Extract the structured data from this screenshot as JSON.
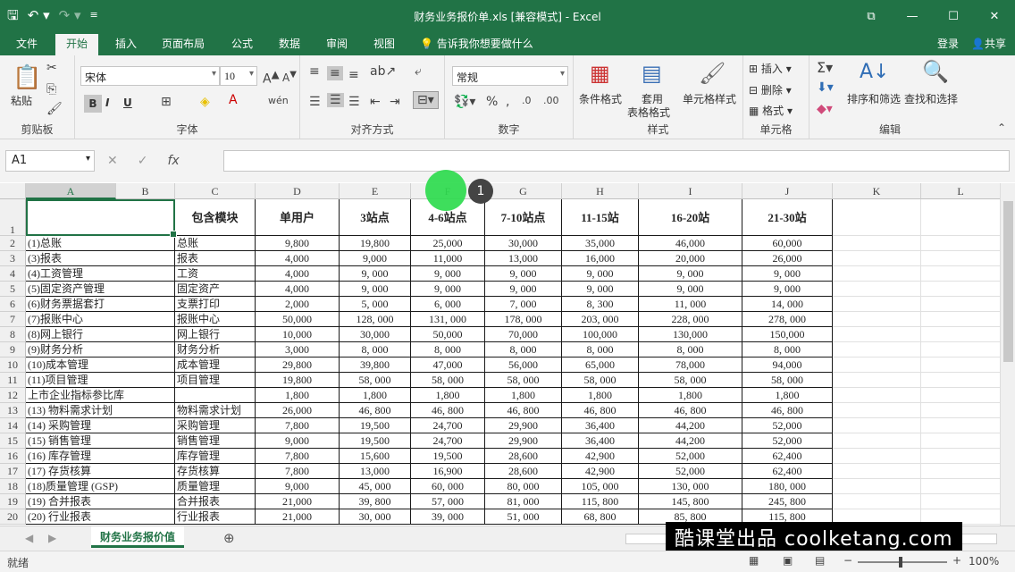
{
  "window": {
    "title": "财务业务报价单.xls  [兼容模式] - Excel"
  },
  "tabs": [
    "文件",
    "开始",
    "插入",
    "页面布局",
    "公式",
    "数据",
    "审阅",
    "视图"
  ],
  "tell_me": "告诉我你想要做什么",
  "login": "登录",
  "share": "共享",
  "ribbon": {
    "clipboard": {
      "paste": "粘贴",
      "label": "剪贴板"
    },
    "font": {
      "name": "宋体",
      "size": "10",
      "label": "字体",
      "bold": "B",
      "italic": "I",
      "underline": "U"
    },
    "align": {
      "label": "对齐方式"
    },
    "number": {
      "format": "常规",
      "label": "数字"
    },
    "styles": {
      "cond": "条件格式",
      "table1": "套用",
      "table2": "表格格式",
      "cell": "单元格样式",
      "label": "样式"
    },
    "cells": {
      "insert": "插入",
      "delete": "删除",
      "format": "格式",
      "label": "单元格"
    },
    "editing": {
      "sort": "排序和筛选",
      "find": "查找和选择",
      "label": "编辑"
    }
  },
  "formula": {
    "namebox": "A1"
  },
  "columns": [
    "A",
    "B",
    "C",
    "D",
    "E",
    "F",
    "G",
    "H",
    "I",
    "J",
    "K",
    "L"
  ],
  "headers": [
    "",
    "包含模块",
    "单用户",
    "3站点",
    "4-6站点",
    "7-10站点",
    "11-15站",
    "16-20站",
    "21-30站"
  ],
  "rows": [
    {
      "n": "2",
      "a": "(1)总账",
      "c": "总账",
      "v": [
        "9,800",
        "19,800",
        "25,000",
        "30,000",
        "35,000",
        "46,000",
        "60,000"
      ]
    },
    {
      "n": "3",
      "a": "(3)报表",
      "c": "报表",
      "v": [
        "4,000",
        "9,000",
        "11,000",
        "13,000",
        "16,000",
        "20,000",
        "26,000"
      ]
    },
    {
      "n": "4",
      "a": "(4)工资管理",
      "c": "工资",
      "v": [
        "4,000",
        "9, 000",
        "9, 000",
        "9, 000",
        "9, 000",
        "9, 000",
        "9, 000"
      ]
    },
    {
      "n": "5",
      "a": "(5)固定资产管理",
      "c": "固定资产",
      "v": [
        "4,000",
        "9, 000",
        "9, 000",
        "9, 000",
        "9, 000",
        "9, 000",
        "9, 000"
      ]
    },
    {
      "n": "6",
      "a": "(6)财务票据套打",
      "c": "支票打印",
      "v": [
        "2,000",
        "5, 000",
        "6, 000",
        "7, 000",
        "8, 300",
        "11, 000",
        "14, 000"
      ]
    },
    {
      "n": "7",
      "a": "(7)报账中心",
      "c": "报账中心",
      "v": [
        "50,000",
        "128, 000",
        "131, 000",
        "178, 000",
        "203, 000",
        "228, 000",
        "278, 000"
      ]
    },
    {
      "n": "8",
      "a": "(8)网上银行",
      "c": "网上银行",
      "v": [
        "10,000",
        "30,000",
        "50,000",
        "70,000",
        "100,000",
        "130,000",
        "150,000"
      ]
    },
    {
      "n": "9",
      "a": "(9)财务分析",
      "c": "财务分析",
      "v": [
        "3,000",
        "8, 000",
        "8, 000",
        "8, 000",
        "8, 000",
        "8, 000",
        "8, 000"
      ]
    },
    {
      "n": "10",
      "a": "(10)成本管理",
      "c": "成本管理",
      "v": [
        "29,800",
        "39,800",
        "47,000",
        "56,000",
        "65,000",
        "78,000",
        "94,000"
      ]
    },
    {
      "n": "11",
      "a": "(11)项目管理",
      "c": "项目管理",
      "v": [
        "19,800",
        "58, 000",
        "58, 000",
        "58, 000",
        "58, 000",
        "58, 000",
        "58, 000"
      ]
    },
    {
      "n": "12",
      "a": "上市企业指标参比库",
      "c": "",
      "v": [
        "1,800",
        "1,800",
        "1,800",
        "1,800",
        "1,800",
        "1,800",
        "1,800"
      ]
    },
    {
      "n": "13",
      "a": "(13) 物料需求计划",
      "c": "物料需求计划",
      "v": [
        "26,000",
        "46, 800",
        "46, 800",
        "46, 800",
        "46, 800",
        "46, 800",
        "46, 800"
      ]
    },
    {
      "n": "14",
      "a": "(14) 采购管理",
      "c": "采购管理",
      "v": [
        "7,800",
        "19,500",
        "24,700",
        "29,900",
        "36,400",
        "44,200",
        "52,000"
      ]
    },
    {
      "n": "15",
      "a": "(15) 销售管理",
      "c": "销售管理",
      "v": [
        "9,000",
        "19,500",
        "24,700",
        "29,900",
        "36,400",
        "44,200",
        "52,000"
      ]
    },
    {
      "n": "16",
      "a": "(16) 库存管理",
      "c": "库存管理",
      "v": [
        "7,800",
        "15,600",
        "19,500",
        "28,600",
        "42,900",
        "52,000",
        "62,400"
      ]
    },
    {
      "n": "17",
      "a": "(17) 存货核算",
      "c": "存货核算",
      "v": [
        "7,800",
        "13,000",
        "16,900",
        "28,600",
        "42,900",
        "52,000",
        "62,400"
      ]
    },
    {
      "n": "18",
      "a": "(18)质量管理 (GSP)",
      "c": "质量管理",
      "v": [
        "9,000",
        "45, 000",
        "60, 000",
        "80, 000",
        "105, 000",
        "130, 000",
        "180, 000"
      ]
    },
    {
      "n": "19",
      "a": "(19) 合并报表",
      "c": "合并报表",
      "v": [
        "21,000",
        "39, 800",
        "57, 000",
        "81, 000",
        "115, 800",
        "145, 800",
        "245, 800"
      ]
    },
    {
      "n": "20",
      "a": "(20) 行业报表",
      "c": "行业报表",
      "v": [
        "21,000",
        "30, 000",
        "39, 000",
        "51, 000",
        "68, 800",
        "85, 800",
        "115, 800"
      ]
    }
  ],
  "sheet_tab": "财务业务报价值",
  "status": {
    "ready": "就绪",
    "zoom": "100%"
  },
  "marker": "1",
  "watermark": "酷课堂出品 coolketang.com"
}
